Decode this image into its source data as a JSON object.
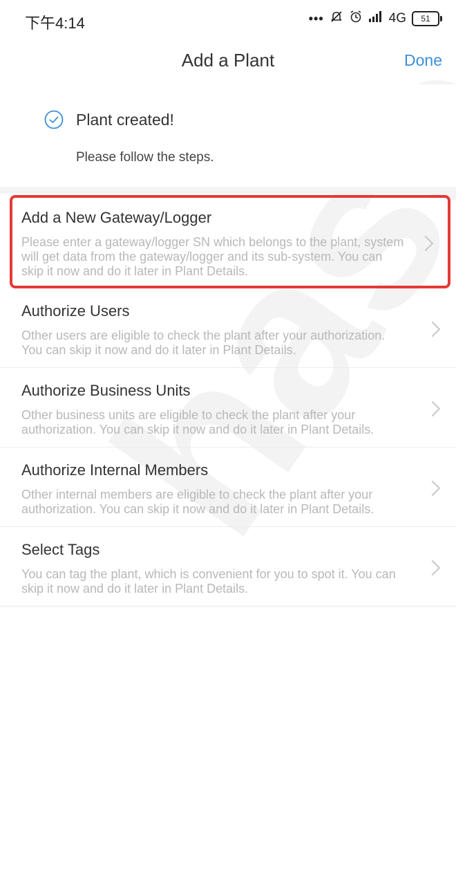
{
  "status_bar": {
    "time": "下午4:14",
    "signal_text": "4G",
    "battery": "51",
    "icons": [
      "more-dots-icon",
      "mute-icon",
      "alarm-icon",
      "signal-icon",
      "battery-icon"
    ]
  },
  "nav": {
    "title": "Add a Plant",
    "done_label": "Done"
  },
  "created": {
    "title": "Plant created!",
    "subtitle": "Please follow the steps.",
    "icon": "check-circle-icon",
    "accent_color": "#3b8fd8"
  },
  "steps": [
    {
      "title": "Add a New Gateway/Logger",
      "description": "Please enter a gateway/logger SN which belongs to the plant, system will get data from the gateway/logger and its sub-system. You can skip it now and do it later in Plant Details.",
      "highlighted": true
    },
    {
      "title": "Authorize Users",
      "description": "Other users are eligible to check the plant after your authorization. You can skip it now and do it later in Plant Details."
    },
    {
      "title": "Authorize Business Units",
      "description": "Other business units are eligible to check the plant after your authorization. You can skip it now and do it later in Plant Details."
    },
    {
      "title": "Authorize Internal Members",
      "description": "Other internal members are eligible to check the plant after your authorization. You can skip it now and do it later in Plant Details."
    },
    {
      "title": "Select Tags",
      "description": "You can tag the plant, which is convenient for you to spot it. You can skip it now and do it later in Plant Details."
    }
  ],
  "colors": {
    "highlight_border": "#e53935",
    "description_text": "#b8b8b8"
  }
}
